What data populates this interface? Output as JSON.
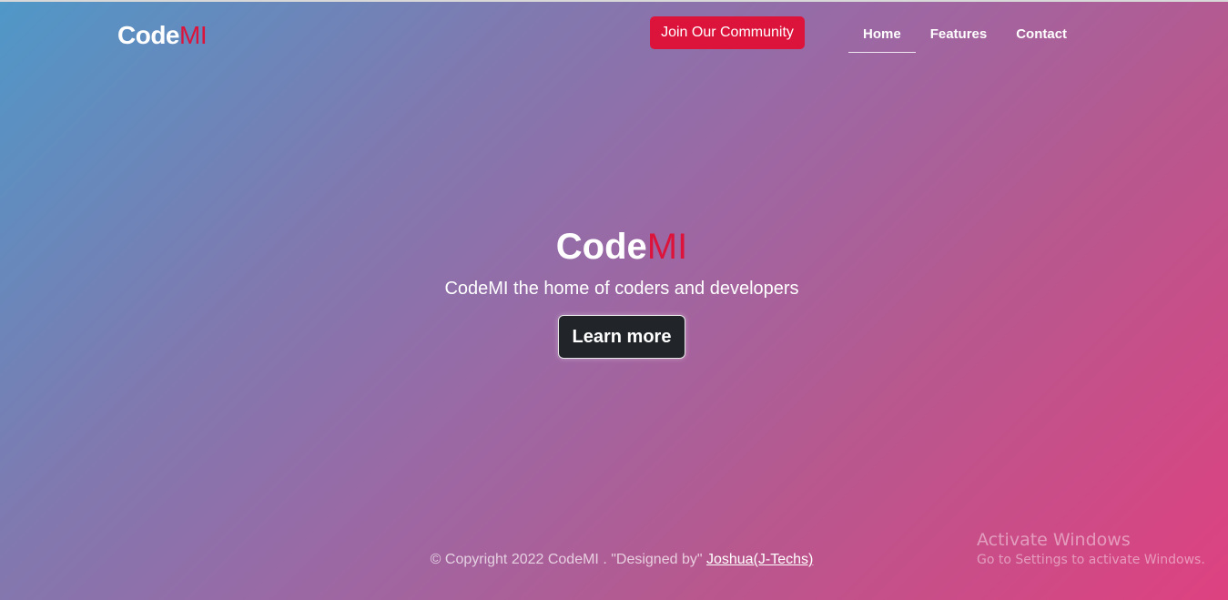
{
  "brand": {
    "code": "Code",
    "mi": "MI",
    "accent_color": "#dc143c"
  },
  "header": {
    "community_button": "Join Our Community",
    "nav": [
      {
        "label": "Home",
        "active": true
      },
      {
        "label": "Features",
        "active": false
      },
      {
        "label": "Contact",
        "active": false
      }
    ]
  },
  "hero": {
    "title_code": "Code",
    "title_mi": "MI",
    "subtitle": "CodeMI the home of coders and developers",
    "button": "Learn more"
  },
  "footer": {
    "text": "© Copyright 2022 CodeMI . \"Designed by\"",
    "link": "Joshua(J-Techs)"
  },
  "watermark": {
    "title": "Activate Windows",
    "subtitle": "Go to Settings to activate Windows."
  },
  "colors": {
    "gradient_start": "#4f98c8",
    "gradient_end": "#de4180",
    "button_dark": "#212529"
  }
}
